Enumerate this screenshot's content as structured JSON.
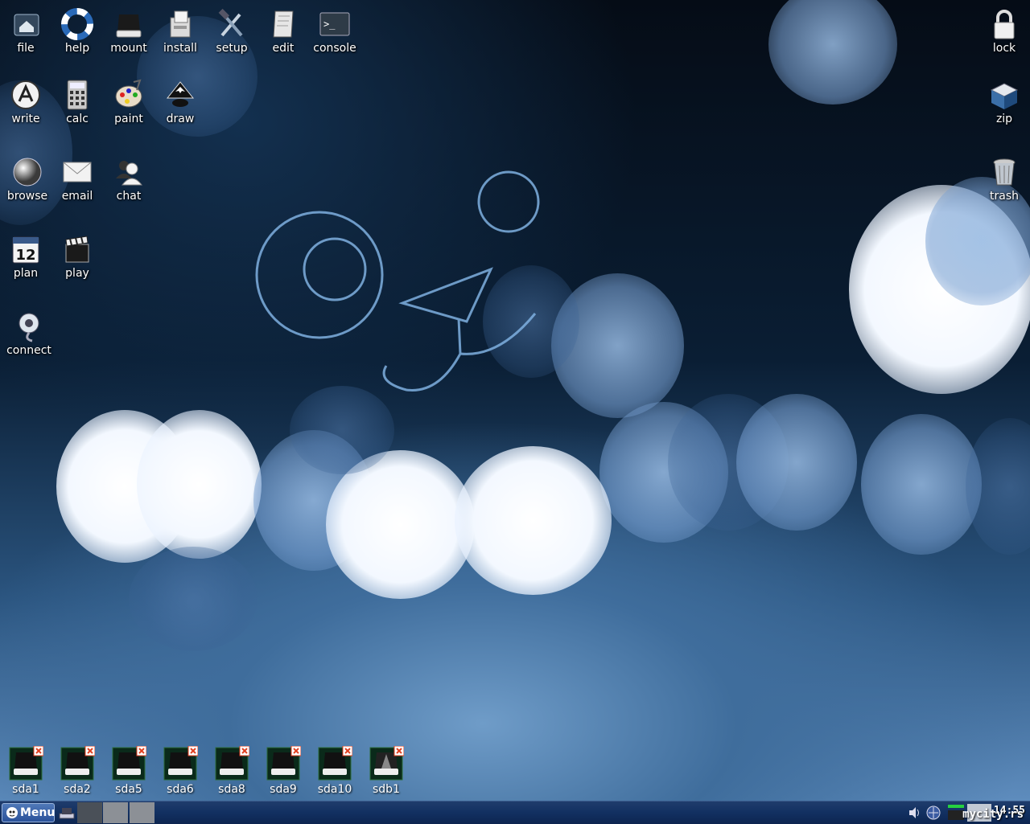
{
  "desktop": {
    "left_icons": [
      {
        "label": "file",
        "icon": "home-folder-icon"
      },
      {
        "label": "help",
        "icon": "lifebuoy-icon"
      },
      {
        "label": "mount",
        "icon": "drive-icon"
      },
      {
        "label": "install",
        "icon": "package-box-icon"
      },
      {
        "label": "setup",
        "icon": "wrench-hammer-icon"
      },
      {
        "label": "edit",
        "icon": "notepad-icon"
      },
      {
        "label": "console",
        "icon": "terminal-icon"
      },
      {
        "label": "write",
        "icon": "word-processor-icon"
      },
      {
        "label": "calc",
        "icon": "calculator-icon"
      },
      {
        "label": "paint",
        "icon": "paint-palette-icon"
      },
      {
        "label": "draw",
        "icon": "inkscape-icon"
      },
      {
        "label": "browse",
        "icon": "globe-icon"
      },
      {
        "label": "email",
        "icon": "envelope-icon"
      },
      {
        "label": "chat",
        "icon": "chat-people-icon"
      },
      {
        "label": "plan",
        "icon": "calendar-icon"
      },
      {
        "label": "play",
        "icon": "clapperboard-icon"
      },
      {
        "label": "connect",
        "icon": "network-connect-icon"
      }
    ],
    "right_icons": [
      {
        "label": "lock",
        "icon": "padlock-icon"
      },
      {
        "label": "zip",
        "icon": "archive-box-icon"
      },
      {
        "label": "trash",
        "icon": "trash-can-icon"
      }
    ],
    "calendar_day": "12",
    "drives": [
      {
        "label": "sda1"
      },
      {
        "label": "sda2"
      },
      {
        "label": "sda5"
      },
      {
        "label": "sda6"
      },
      {
        "label": "sda8"
      },
      {
        "label": "sda9"
      },
      {
        "label": "sda10"
      },
      {
        "label": "sdb1"
      }
    ]
  },
  "taskbar": {
    "menu_label": "Menu",
    "clock": "14:55",
    "watermark": "mycity.rs"
  },
  "colors": {
    "taskbar": "#123061",
    "menu_button": "#2b529a",
    "icon_label": "#ffffff",
    "drive_unmounted_badge": "#e04020"
  }
}
